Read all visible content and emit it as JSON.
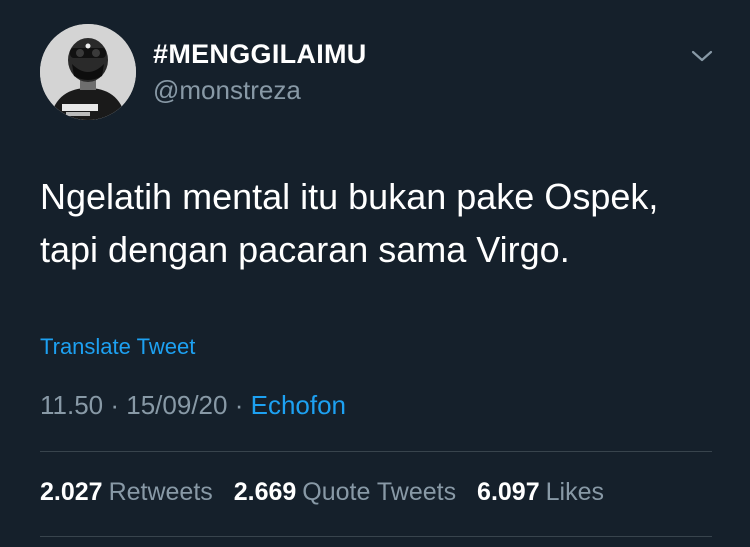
{
  "user": {
    "display_name": "#MENGGILAIMU",
    "handle": "@monstreza"
  },
  "tweet": {
    "lines": [
      "Ngelatih mental itu bukan pake Ospek,",
      "tapi dengan pacaran sama Virgo."
    ],
    "translate_label": "Translate Tweet",
    "time": "11.50",
    "date": "15/09/20",
    "separator": "·",
    "source": "Echofon"
  },
  "stats": {
    "retweets_count": "2.027",
    "retweets_label": "Retweets",
    "quote_tweets_count": "2.669",
    "quote_tweets_label": "Quote Tweets",
    "likes_count": "6.097",
    "likes_label": "Likes"
  },
  "icons": {
    "more": "chevron-down-icon"
  },
  "colors": {
    "background": "#15202b",
    "primary_text": "#ffffff",
    "secondary_text": "#8899a6",
    "accent": "#1da1f2",
    "divider": "#38444d"
  }
}
